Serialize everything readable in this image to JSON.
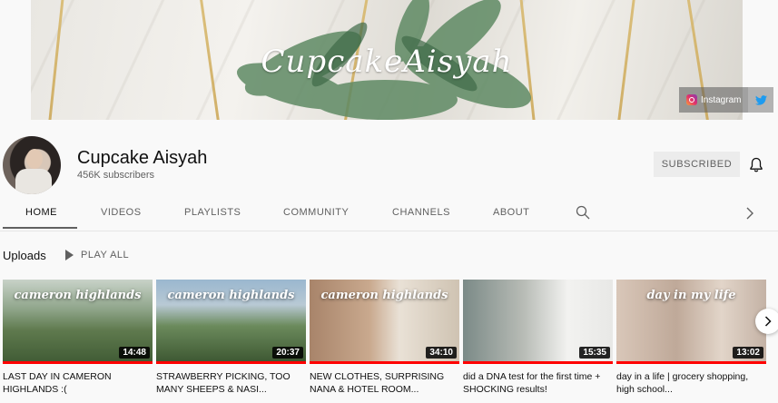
{
  "banner": {
    "title": "CupcakeAisyah",
    "social": {
      "instagram_label": "Instagram",
      "twitter_icon": "twitter-icon"
    }
  },
  "channel": {
    "name": "Cupcake Aisyah",
    "subscribers": "456K subscribers",
    "subscribe_label": "SUBSCRIBED"
  },
  "tabs": [
    {
      "label": "HOME",
      "active": true
    },
    {
      "label": "VIDEOS"
    },
    {
      "label": "PLAYLISTS"
    },
    {
      "label": "COMMUNITY"
    },
    {
      "label": "CHANNELS"
    },
    {
      "label": "ABOUT"
    }
  ],
  "uploads": {
    "title": "Uploads",
    "play_all": "PLAY ALL",
    "videos": [
      {
        "thumb_text": "cameron highlands",
        "duration": "14:48",
        "title": "LAST DAY IN CAMERON HIGHLANDS :(",
        "watched": 1.0
      },
      {
        "thumb_text": "cameron highlands",
        "duration": "20:37",
        "title": "STRAWBERRY PICKING, TOO MANY SHEEPS & NASI...",
        "watched": 1.0
      },
      {
        "thumb_text": "cameron highlands",
        "duration": "34:10",
        "title": "NEW CLOTHES, SURPRISING NANA & HOTEL ROOM...",
        "watched": 1.0
      },
      {
        "thumb_text": "",
        "duration": "15:35",
        "title": "did a DNA test for the first time + SHOCKING results!",
        "watched": 1.0
      },
      {
        "thumb_text": "day in my life",
        "duration": "13:02",
        "title": "day in a life | grocery shopping, high school...",
        "watched": 1.0
      }
    ]
  },
  "colors": {
    "progress": "#ff0000",
    "instagram": "#e1306c",
    "twitter": "#1d9bf0"
  }
}
